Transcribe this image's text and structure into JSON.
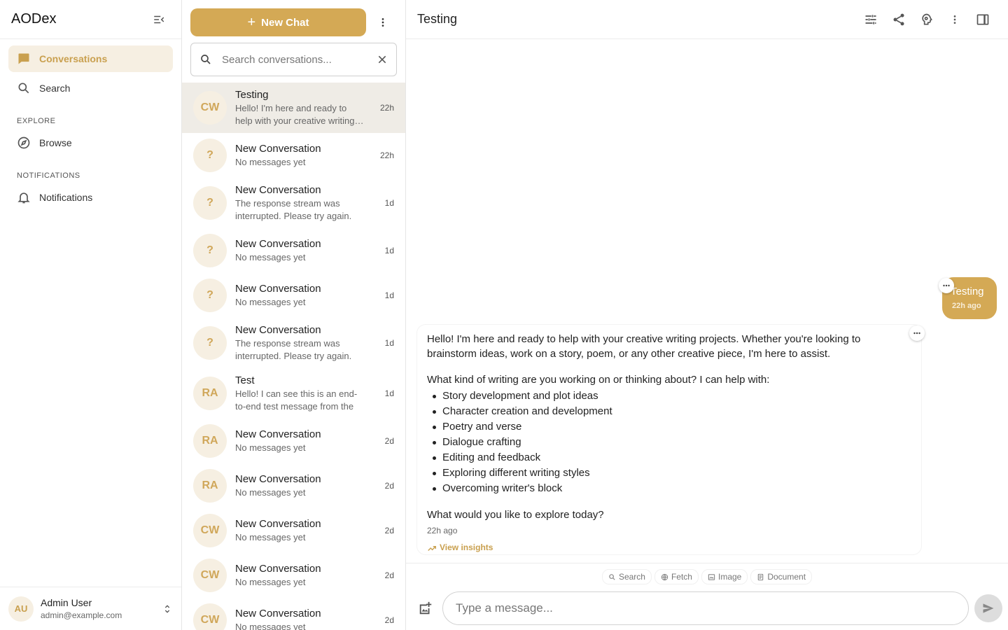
{
  "app": {
    "name": "AODex"
  },
  "nav": {
    "items": [
      {
        "label": "Conversations",
        "icon": "chat-bubble-icon"
      },
      {
        "label": "Search",
        "icon": "search-icon"
      }
    ],
    "explore_heading": "EXPLORE",
    "browse_label": "Browse",
    "notifications_heading": "NOTIFICATIONS",
    "notifications_label": "Notifications"
  },
  "user": {
    "initials": "AU",
    "name": "Admin User",
    "email": "admin@example.com"
  },
  "list": {
    "new_chat_label": "New Chat",
    "search_placeholder": "Search conversations...",
    "conversations": [
      {
        "initials": "CW",
        "title": "Testing",
        "preview": "Hello! I'm here and ready to help with your creative writing projects.",
        "time": "22h"
      },
      {
        "initials": "?",
        "title": "New Conversation",
        "preview": "No messages yet",
        "time": "22h"
      },
      {
        "initials": "?",
        "title": "New Conversation",
        "preview": "The response stream was interrupted. Please try again.",
        "time": "1d"
      },
      {
        "initials": "?",
        "title": "New Conversation",
        "preview": "No messages yet",
        "time": "1d"
      },
      {
        "initials": "?",
        "title": "New Conversation",
        "preview": "No messages yet",
        "time": "1d"
      },
      {
        "initials": "?",
        "title": "New Conversation",
        "preview": "The response stream was interrupted. Please try again.",
        "time": "1d"
      },
      {
        "initials": "RA",
        "title": "Test",
        "preview": "Hello! I can see this is an end-to-end test message from the",
        "time": "1d"
      },
      {
        "initials": "RA",
        "title": "New Conversation",
        "preview": "No messages yet",
        "time": "2d"
      },
      {
        "initials": "RA",
        "title": "New Conversation",
        "preview": "No messages yet",
        "time": "2d"
      },
      {
        "initials": "CW",
        "title": "New Conversation",
        "preview": "No messages yet",
        "time": "2d"
      },
      {
        "initials": "CW",
        "title": "New Conversation",
        "preview": "No messages yet",
        "time": "2d"
      },
      {
        "initials": "CW",
        "title": "New Conversation",
        "preview": "No messages yet",
        "time": "2d"
      }
    ]
  },
  "chat": {
    "title": "Testing",
    "user_message": {
      "text": "Testing",
      "time": "22h ago"
    },
    "assistant_message": {
      "intro": "Hello! I'm here and ready to help with your creative writing projects. Whether you're looking to brainstorm ideas, work on a story, poem, or any other creative piece, I'm here to assist.",
      "question": "What kind of writing are you working on or thinking about? I can help with:",
      "bullets": [
        "Story development and plot ideas",
        "Character creation and development",
        "Poetry and verse",
        "Dialogue crafting",
        "Editing and feedback",
        "Exploring different writing styles",
        "Overcoming writer's block"
      ],
      "closing": "What would you like to explore today?",
      "time": "22h ago",
      "insights_label": "View insights"
    },
    "tools": [
      "Search",
      "Fetch",
      "Image",
      "Document"
    ],
    "input_placeholder": "Type a message..."
  },
  "colors": {
    "accent": "#d4a955",
    "accent_light": "#f6efe2",
    "selected_row": "#efece6"
  }
}
